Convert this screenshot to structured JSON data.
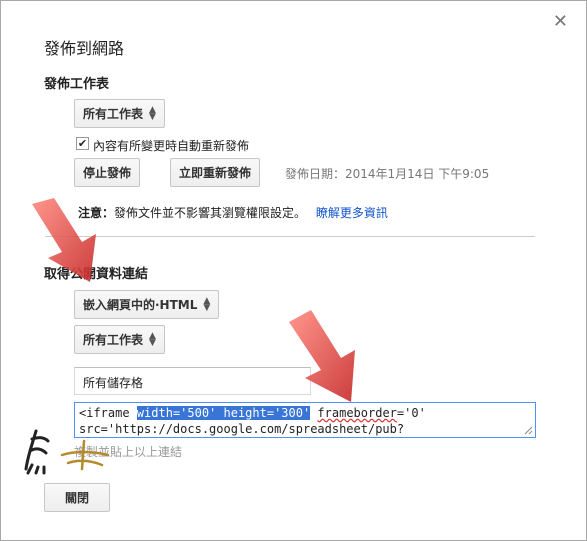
{
  "dialog": {
    "title": "發佈到網路",
    "close_icon": "close-icon"
  },
  "publish": {
    "heading": "發佈工作表",
    "sheet_select": "所有工作表",
    "auto_republish_checked": true,
    "auto_republish_label": "內容有所變更時自動重新發佈",
    "stop_button": "停止發佈",
    "republish_button": "立即重新發佈",
    "publish_date": "發佈日期：2014年1月14日 下午9:05"
  },
  "note": {
    "label": "注意：",
    "text": "發佈文件並不影響其瀏覽權限設定。",
    "link": "瞭解更多資訊"
  },
  "link_section": {
    "heading": "取得公開資料連結",
    "format_select": "嵌入網頁中的·HTML",
    "sheet_select": "所有工作表",
    "range_field": "所有儲存格",
    "code_line1_prefix": "<iframe ",
    "code_line1_selected": "width='500' height='300'",
    "code_line1_suffix": " ",
    "code_line1_frameborder": "frameborder",
    "code_line1_end": "='0'",
    "code_line2": "src='https://docs.google.com/spreadsheet/pub?",
    "hint": "複製並貼上以上連結"
  },
  "footer": {
    "close_button": "關閉"
  },
  "colors": {
    "accent_link": "#1155cc",
    "selection": "#3875d7",
    "focus_border": "#4d90fe",
    "annotation_arrow": "#e53935"
  }
}
